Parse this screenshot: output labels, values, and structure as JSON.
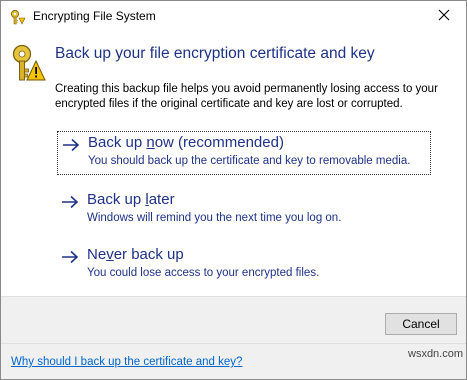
{
  "window": {
    "title": "Encrypting File System",
    "close_icon": "close-icon"
  },
  "header": {
    "heading": "Back up your file encryption certificate and key",
    "description": "Creating this backup file helps you avoid permanently losing access to your encrypted files if the original certificate and key are lost or corrupted.",
    "icon": "key-warning-icon"
  },
  "options": [
    {
      "title_before": "Back up ",
      "title_access": "n",
      "title_after": "ow (recommended)",
      "description": "You should back up the certificate and key to removable media.",
      "selected": true
    },
    {
      "title_before": "Back up ",
      "title_access": "l",
      "title_after": "ater",
      "description": "Windows will remind you the next time you log on.",
      "selected": false
    },
    {
      "title_before": "Ne",
      "title_access": "v",
      "title_after": "er back up",
      "description": "You could lose access to your encrypted files.",
      "selected": false
    }
  ],
  "footer": {
    "cancel_label": "Cancel",
    "help_link": "Why should I back up the certificate and key?",
    "watermark": "wsxdn.com"
  },
  "colors": {
    "heading_blue": "#1e3287",
    "link_blue": "#0066cc",
    "footer_bg": "#f0f0f0"
  }
}
